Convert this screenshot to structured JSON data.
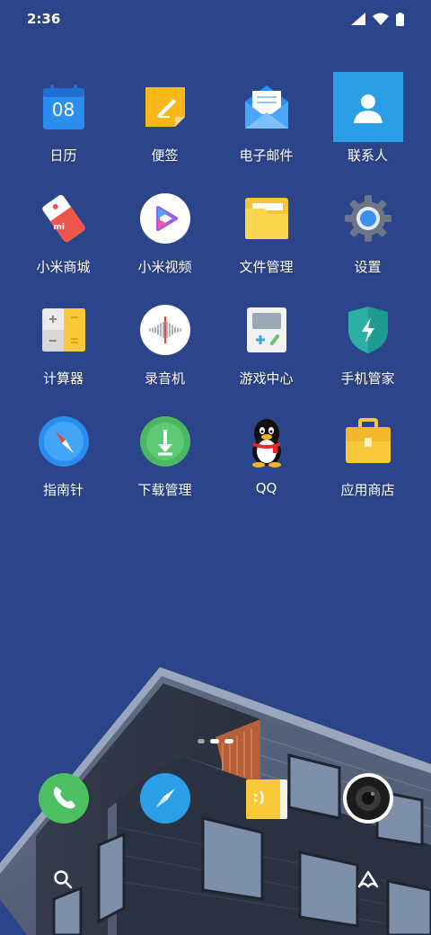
{
  "status_bar": {
    "time": "2:36"
  },
  "apps": [
    {
      "id": "calendar",
      "label": "日历",
      "icon": "calendar-icon",
      "date": "08"
    },
    {
      "id": "notes",
      "label": "便签",
      "icon": "notes-icon"
    },
    {
      "id": "email",
      "label": "电子邮件",
      "icon": "email-icon"
    },
    {
      "id": "contacts",
      "label": "联系人",
      "icon": "contacts-icon",
      "selected": true
    },
    {
      "id": "mi-mall",
      "label": "小米商城",
      "icon": "mi-mall-icon",
      "badge": "mi"
    },
    {
      "id": "mi-video",
      "label": "小米视频",
      "icon": "video-play-icon"
    },
    {
      "id": "file-manager",
      "label": "文件管理",
      "icon": "folder-icon"
    },
    {
      "id": "settings",
      "label": "设置",
      "icon": "gear-icon"
    },
    {
      "id": "calculator",
      "label": "计算器",
      "icon": "calculator-icon"
    },
    {
      "id": "recorder",
      "label": "录音机",
      "icon": "sound-wave-icon"
    },
    {
      "id": "game-center",
      "label": "游戏中心",
      "icon": "gameboy-icon"
    },
    {
      "id": "security",
      "label": "手机管家",
      "icon": "shield-bolt-icon"
    },
    {
      "id": "compass",
      "label": "指南针",
      "icon": "compass-icon"
    },
    {
      "id": "downloads",
      "label": "下载管理",
      "icon": "download-icon"
    },
    {
      "id": "qq",
      "label": "QQ",
      "icon": "penguin-icon"
    },
    {
      "id": "app-store",
      "label": "应用商店",
      "icon": "briefcase-icon"
    }
  ],
  "dock": [
    {
      "id": "phone",
      "icon": "phone-icon"
    },
    {
      "id": "browser",
      "icon": "browser-compass-icon"
    },
    {
      "id": "messages",
      "icon": "message-smile-icon",
      "text": ":)"
    },
    {
      "id": "camera",
      "icon": "camera-icon"
    }
  ],
  "bottom_bar": {
    "left_icon": "search-icon",
    "right_icon": "assistant-icon"
  },
  "colors": {
    "background": "#2c4489",
    "selected": "#2a9ee6"
  }
}
